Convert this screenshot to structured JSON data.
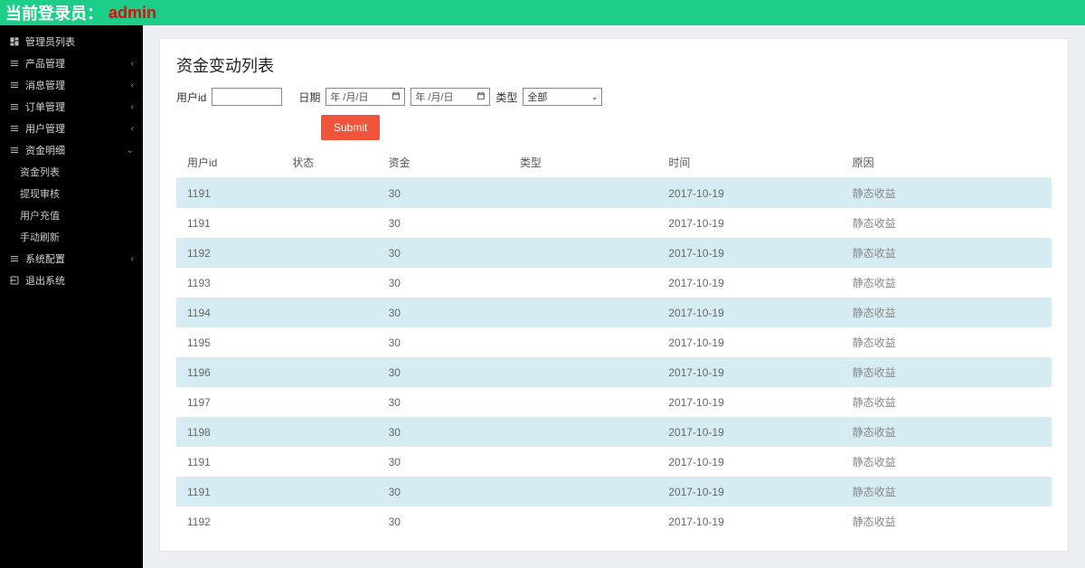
{
  "header": {
    "prefix": "当前登录员：",
    "user": "admin"
  },
  "sidebar": {
    "items": [
      {
        "label": "管理员列表",
        "icon": "dashboard",
        "caret": ""
      },
      {
        "label": "产品管理",
        "icon": "list",
        "caret": "‹"
      },
      {
        "label": "消息管理",
        "icon": "list",
        "caret": "‹"
      },
      {
        "label": "订单管理",
        "icon": "list",
        "caret": "‹"
      },
      {
        "label": "用户管理",
        "icon": "list",
        "caret": "‹"
      },
      {
        "label": "资金明细",
        "icon": "list",
        "caret": "⌄",
        "children": [
          {
            "label": "资金列表"
          },
          {
            "label": "提现审核"
          },
          {
            "label": "用户充值"
          },
          {
            "label": "手动刷新"
          }
        ]
      },
      {
        "label": "系统配置",
        "icon": "list",
        "caret": "‹"
      },
      {
        "label": "退出系统",
        "icon": "logout",
        "caret": ""
      }
    ]
  },
  "page": {
    "title": "资金变动列表"
  },
  "filters": {
    "user_label": "用户id",
    "date_label": "日期",
    "date_placeholder": "年 /月/日",
    "type_label": "类型",
    "type_value": "全部",
    "submit": "Submit"
  },
  "table": {
    "headers": [
      "用户id",
      "状态",
      "资金",
      "类型",
      "时间",
      "原因"
    ],
    "rows": [
      {
        "uid": "1191",
        "status": "",
        "amount": "30",
        "type": "",
        "time": "2017-10-19",
        "reason": "静态收益"
      },
      {
        "uid": "1191",
        "status": "",
        "amount": "30",
        "type": "",
        "time": "2017-10-19",
        "reason": "静态收益"
      },
      {
        "uid": "1192",
        "status": "",
        "amount": "30",
        "type": "",
        "time": "2017-10-19",
        "reason": "静态收益"
      },
      {
        "uid": "1193",
        "status": "",
        "amount": "30",
        "type": "",
        "time": "2017-10-19",
        "reason": "静态收益"
      },
      {
        "uid": "1194",
        "status": "",
        "amount": "30",
        "type": "",
        "time": "2017-10-19",
        "reason": "静态收益"
      },
      {
        "uid": "1195",
        "status": "",
        "amount": "30",
        "type": "",
        "time": "2017-10-19",
        "reason": "静态收益"
      },
      {
        "uid": "1196",
        "status": "",
        "amount": "30",
        "type": "",
        "time": "2017-10-19",
        "reason": "静态收益"
      },
      {
        "uid": "1197",
        "status": "",
        "amount": "30",
        "type": "",
        "time": "2017-10-19",
        "reason": "静态收益"
      },
      {
        "uid": "1198",
        "status": "",
        "amount": "30",
        "type": "",
        "time": "2017-10-19",
        "reason": "静态收益"
      },
      {
        "uid": "1191",
        "status": "",
        "amount": "30",
        "type": "",
        "time": "2017-10-19",
        "reason": "静态收益"
      },
      {
        "uid": "1191",
        "status": "",
        "amount": "30",
        "type": "",
        "time": "2017-10-19",
        "reason": "静态收益"
      },
      {
        "uid": "1192",
        "status": "",
        "amount": "30",
        "type": "",
        "time": "2017-10-19",
        "reason": "静态收益"
      }
    ]
  }
}
